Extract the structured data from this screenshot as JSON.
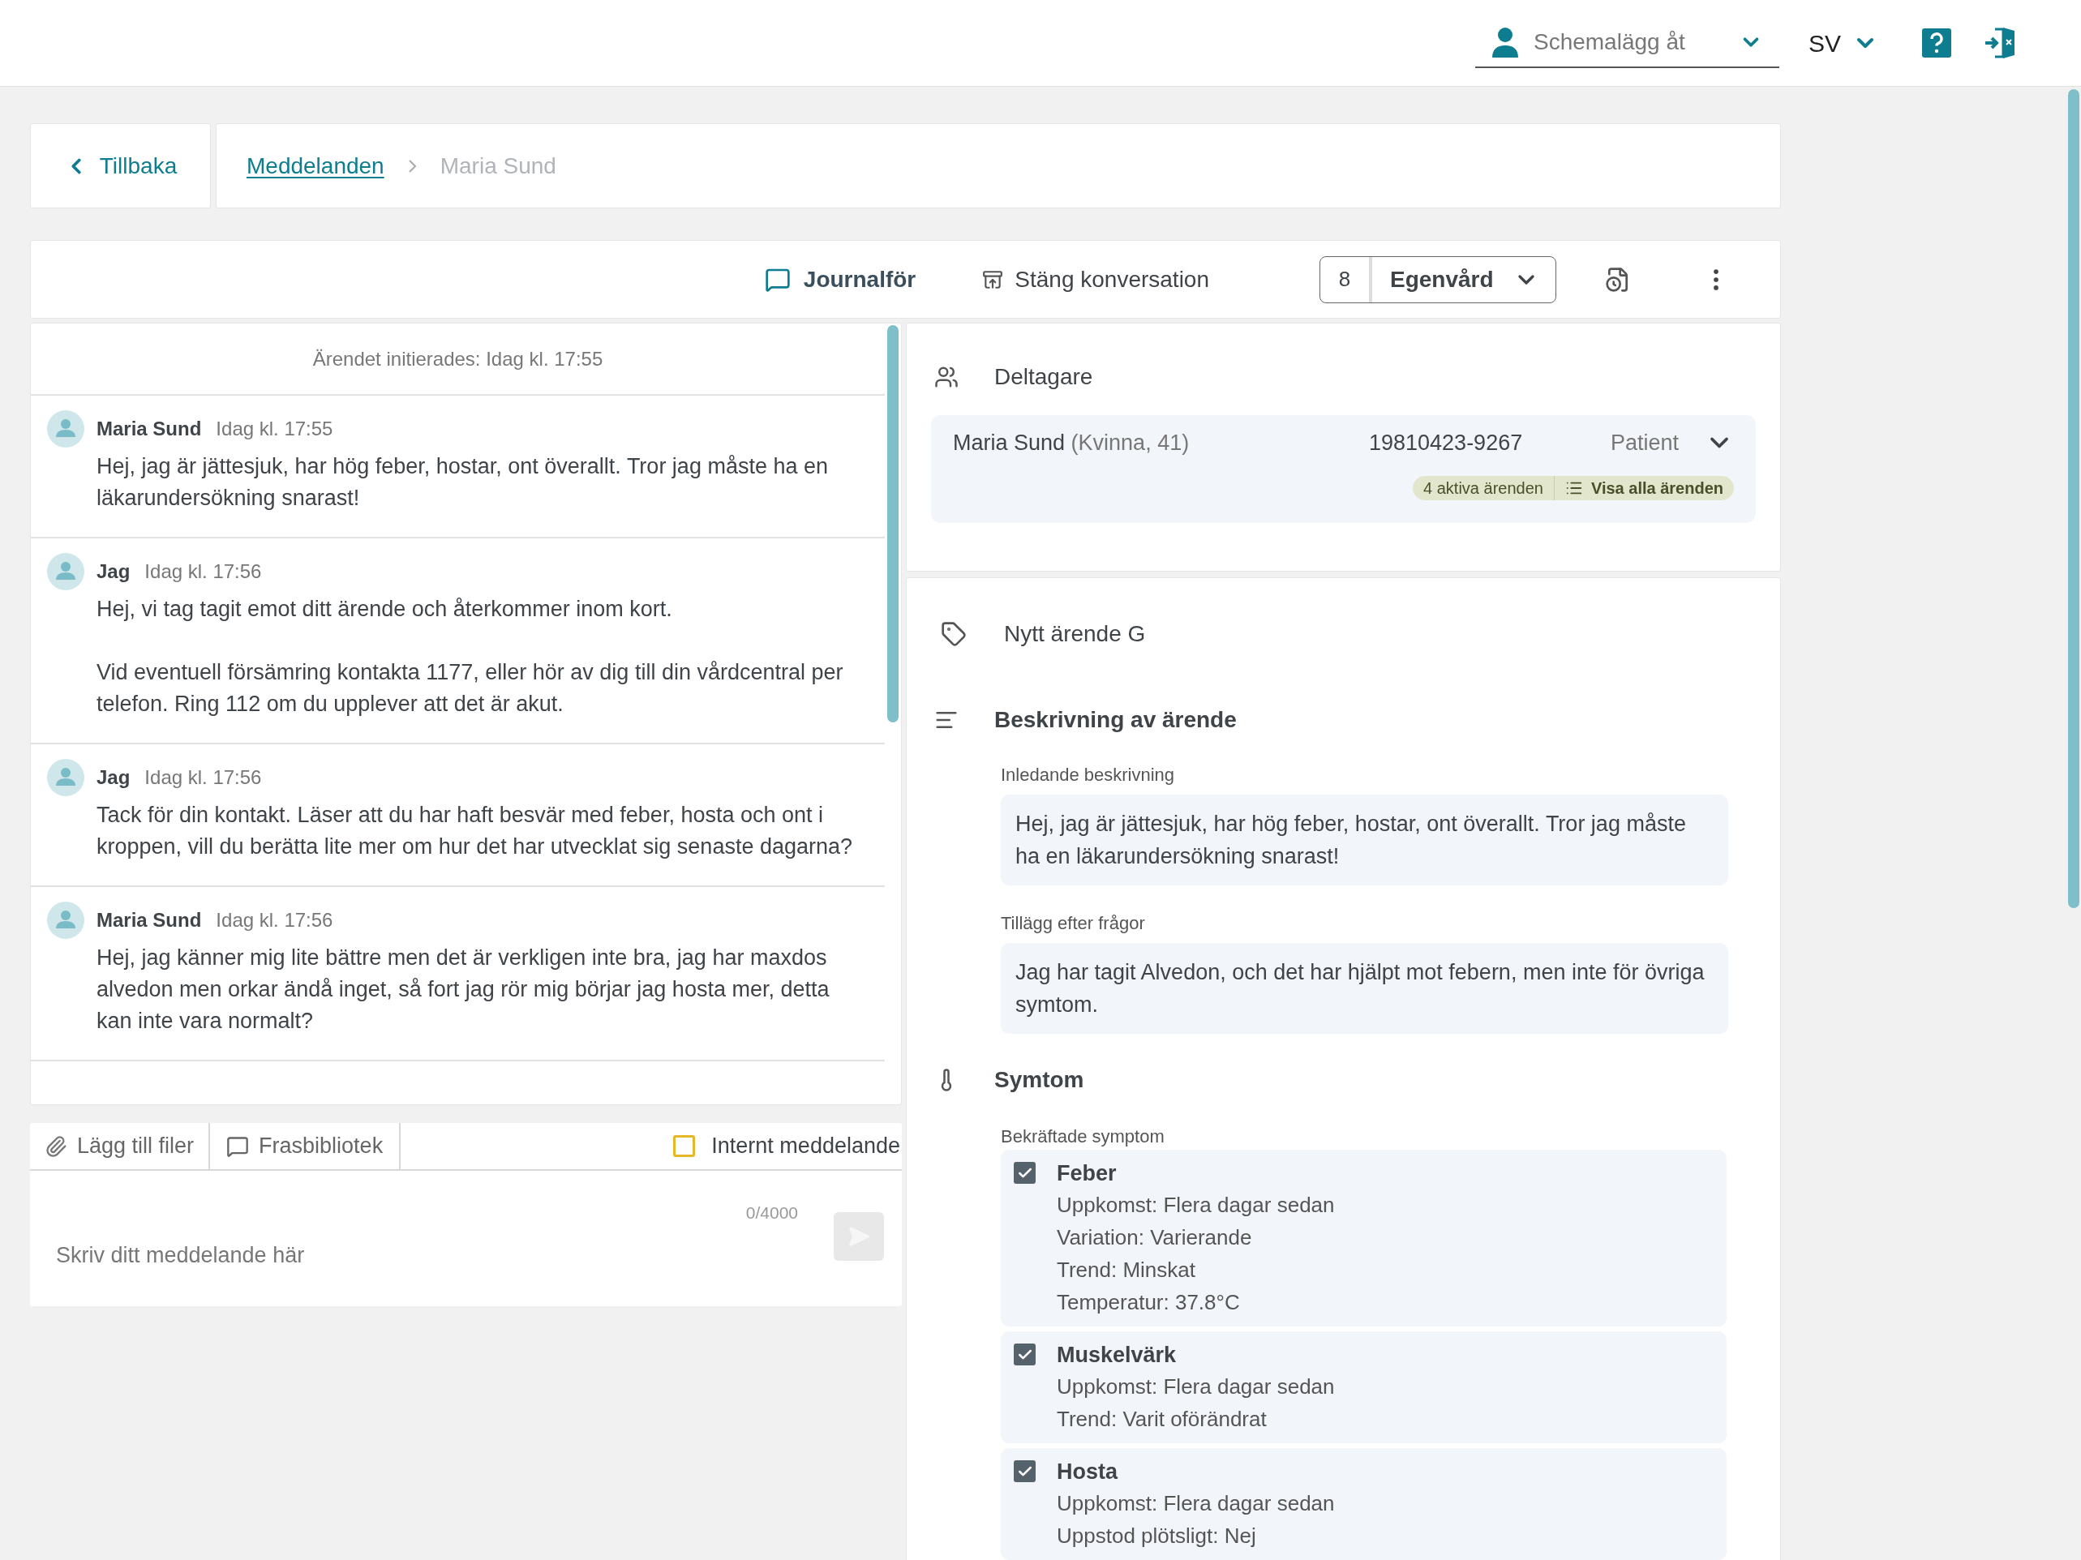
{
  "header": {
    "schedule_select": {
      "placeholder": "Schemalägg åt"
    },
    "language": "SV"
  },
  "breadcrumb": {
    "back": "Tillbaka",
    "items": [
      {
        "label": "Meddelanden",
        "kind": "link"
      },
      {
        "label": "Maria Sund",
        "kind": "current"
      }
    ]
  },
  "toolbar": {
    "journal": "Journalför",
    "close": "Stäng konversation",
    "count": "8",
    "category": "Egenvård"
  },
  "chat": {
    "initiated": "Ärendet initierades: Idag kl. 17:55",
    "messages": [
      {
        "author": "Maria Sund",
        "time": "Idag kl. 17:55",
        "paragraphs": [
          "Hej, jag är jättesjuk, har hög feber, hostar, ont överallt. Tror jag måste ha en läkarundersökning snarast!"
        ]
      },
      {
        "author": "Jag",
        "time": "Idag kl. 17:56",
        "paragraphs": [
          "Hej, vi tag tagit emot ditt ärende och återkommer inom kort.",
          "Vid eventuell försämring kontakta 1177, eller hör av dig till din vårdcentral per telefon. Ring 112 om du upplever att det är akut."
        ]
      },
      {
        "author": "Jag",
        "time": "Idag kl. 17:56",
        "paragraphs": [
          "Tack för din kontakt. Läser att du har haft besvär med feber, hosta och ont i kroppen, vill du berätta lite mer om hur det har utvecklat sig senaste dagarna?"
        ]
      },
      {
        "author": "Maria Sund",
        "time": "Idag kl. 17:56",
        "paragraphs": [
          "Hej, jag känner mig lite bättre men det är verkligen inte bra, jag har maxdos alvedon men orkar ändå inget, så fort jag rör mig börjar jag hosta mer, detta kan inte vara normalt?"
        ]
      }
    ]
  },
  "composer": {
    "attach": "Lägg till filer",
    "phrases": "Frasbibliotek",
    "internal": {
      "label": "Internt meddelande",
      "checked": false
    },
    "counter": "0/4000",
    "placeholder": "Skriv ditt meddelande här"
  },
  "participants": {
    "title": "Deltagare",
    "rows": [
      {
        "name": "Maria Sund",
        "details": "(Kvinna, 41)",
        "id": "19810423-9267",
        "role": "Patient",
        "active_cases": "4 aktiva ärenden",
        "show_all": "Visa alla ärenden"
      }
    ]
  },
  "case": {
    "title": "Nytt ärende G",
    "description": {
      "title": "Beskrivning av ärende",
      "fields": [
        {
          "label": "Inledande beskrivning",
          "value": "Hej, jag är jättesjuk, har hög feber, hostar, ont överallt. Tror jag måste ha en läkarundersökning snarast!"
        },
        {
          "label": "Tillägg efter frågor",
          "value": "Jag har tagit Alvedon, och det har hjälpt mot febern, men inte för övriga symtom."
        }
      ]
    },
    "symptoms": {
      "title": "Symtom",
      "subtitle": "Bekräftade symptom",
      "items": [
        {
          "name": "Feber",
          "checked": true,
          "details": [
            "Uppkomst: Flera dagar sedan",
            "Variation: Varierande",
            "Trend: Minskat",
            "Temperatur: 37.8°C"
          ]
        },
        {
          "name": "Muskelvärk",
          "checked": true,
          "details": [
            "Uppkomst: Flera dagar sedan",
            "Trend: Varit oförändrat"
          ]
        },
        {
          "name": "Hosta",
          "checked": true,
          "details": [
            "Uppkomst: Flera dagar sedan",
            "Uppstod plötsligt: Nej"
          ]
        }
      ]
    }
  }
}
